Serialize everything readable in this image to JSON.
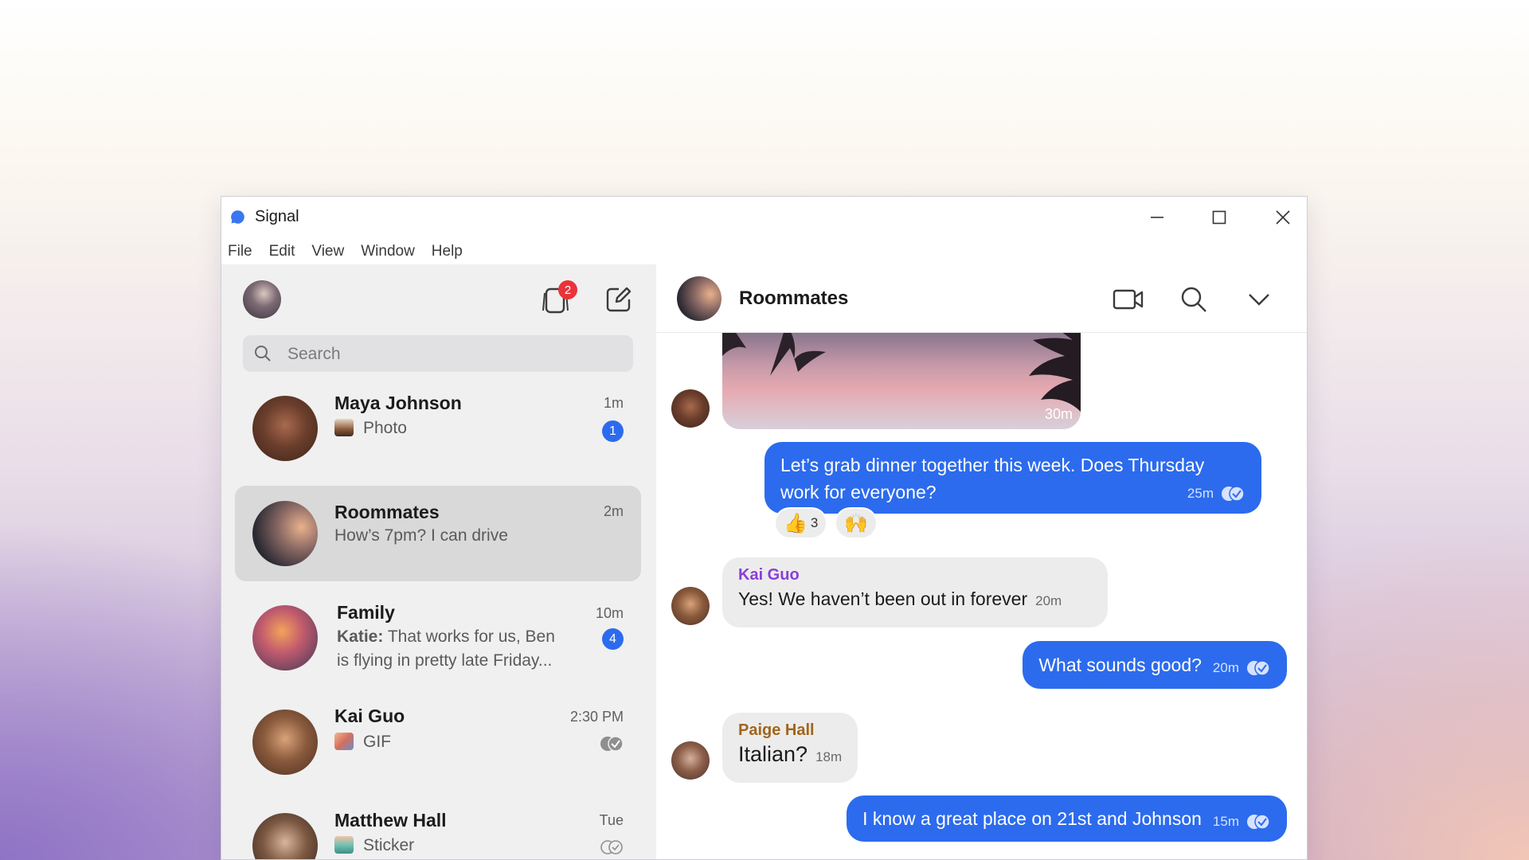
{
  "app": {
    "title": "Signal"
  },
  "menu": [
    "File",
    "Edit",
    "View",
    "Window",
    "Help"
  ],
  "sidebar": {
    "notification_count": "2",
    "search_placeholder": "Search",
    "conversations": [
      {
        "name": "Maya Johnson",
        "time": "1m",
        "preview": "Photo",
        "unread": "1"
      },
      {
        "name": "Roommates",
        "time": "2m",
        "preview": "How’s 7pm? I can drive"
      },
      {
        "name": "Family",
        "time": "10m",
        "preview_sender": "Katie:",
        "preview": "That works for us, Ben",
        "preview_line2": "is flying in pretty late Friday...",
        "unread": "4"
      },
      {
        "name": "Kai Guo",
        "time": "2:30 PM",
        "preview": "GIF"
      },
      {
        "name": "Matthew Hall",
        "time": "Tue",
        "preview": "Sticker"
      }
    ]
  },
  "chat": {
    "title": "Roommates",
    "messages": [
      {
        "type": "image",
        "time": "30m"
      },
      {
        "type": "outgoing",
        "text": "Let’s grab dinner together this week. Does Thursday work for everyone?",
        "time": "25m",
        "reactions": [
          {
            "emoji": "👍",
            "count": "3"
          },
          {
            "emoji": "🙌"
          }
        ]
      },
      {
        "type": "incoming",
        "sender": "Kai Guo",
        "sender_color": "#8a3fd6",
        "text": "Yes! We haven’t been out in forever",
        "time": "20m"
      },
      {
        "type": "outgoing",
        "text": "What sounds good?",
        "time": "20m"
      },
      {
        "type": "incoming",
        "sender": "Paige Hall",
        "sender_color": "#a0661b",
        "text": "Italian?",
        "time": "18m"
      },
      {
        "type": "outgoing",
        "text": "I know a great place on 21st and Johnson",
        "time": "15m"
      }
    ]
  },
  "colors": {
    "accent": "#2c6bed",
    "badge": "#e8343a"
  }
}
